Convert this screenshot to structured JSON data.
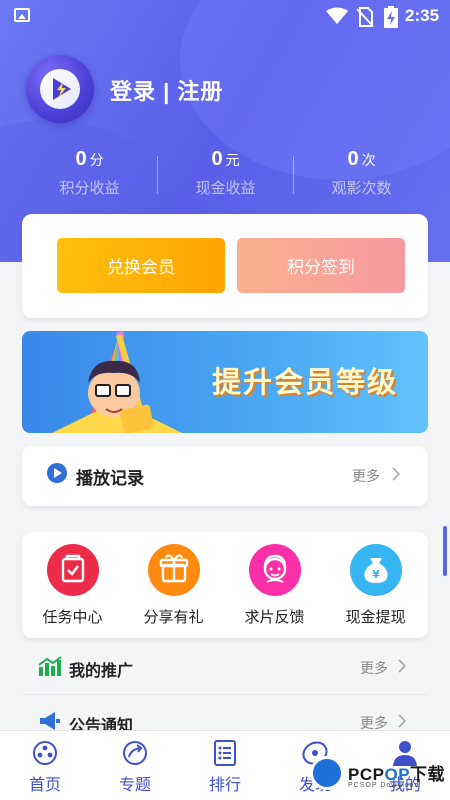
{
  "status_bar": {
    "time": "2:35"
  },
  "profile": {
    "login_label": "登录 | 注册"
  },
  "stats": [
    {
      "value": "0",
      "unit": "分",
      "label": "积分收益"
    },
    {
      "value": "0",
      "unit": "元",
      "label": "现金收益"
    },
    {
      "value": "0",
      "unit": "次",
      "label": "观影次数"
    }
  ],
  "actions": {
    "exchange_label": "兑换会员",
    "signin_label": "积分签到"
  },
  "banner": {
    "text": "提升会员等级"
  },
  "history": {
    "label": "播放记录",
    "more": "更多"
  },
  "grid": [
    {
      "label": "任务中心",
      "icon": "task-icon"
    },
    {
      "label": "分享有礼",
      "icon": "gift-icon"
    },
    {
      "label": "求片反馈",
      "icon": "feedback-icon"
    },
    {
      "label": "现金提现",
      "icon": "money-bag-icon"
    }
  ],
  "list": [
    {
      "label": "我的推广",
      "more": "更多",
      "icon": "chart-icon"
    },
    {
      "label": "公告通知",
      "more": "更多",
      "icon": "megaphone-icon"
    }
  ],
  "tabs": [
    {
      "label": "首页",
      "icon": "home-icon"
    },
    {
      "label": "专题",
      "icon": "topic-icon"
    },
    {
      "label": "排行",
      "icon": "rank-icon"
    },
    {
      "label": "发现",
      "icon": "discover-icon"
    },
    {
      "label": "我的",
      "icon": "profile-icon"
    }
  ],
  "watermark": {
    "brand_a": "PCP",
    "brand_b": "OP",
    "brand_c": "下载",
    "sub": "PCSOP Download"
  },
  "colors": {
    "header": "#5a5ee8",
    "accent": "#3f51c8",
    "exchange": "#ffa405",
    "signin": "#f69aa0"
  }
}
